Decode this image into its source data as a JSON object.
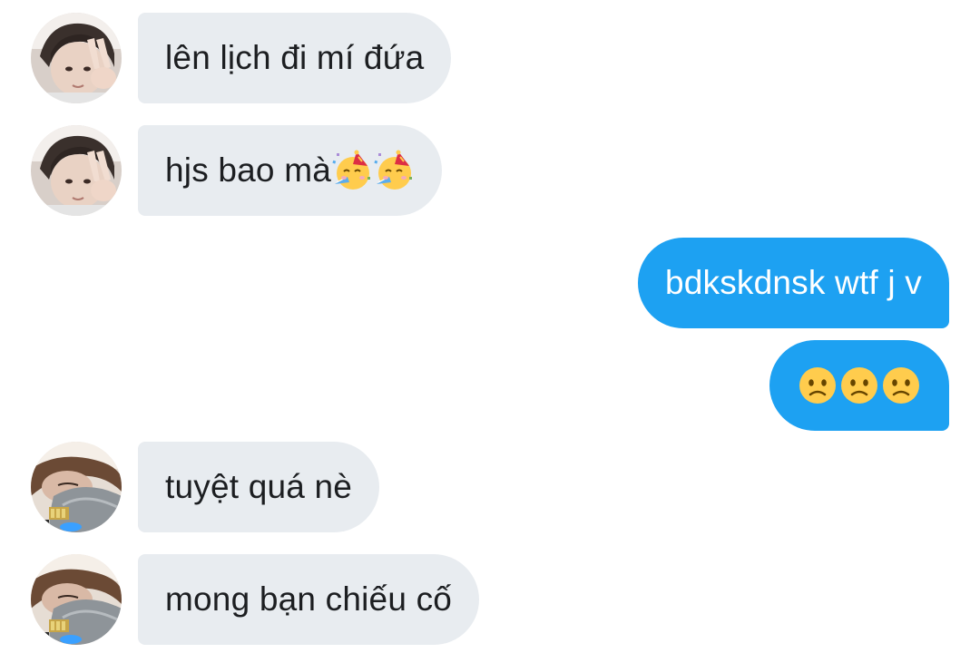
{
  "messages": [
    {
      "direction": "incoming",
      "text": "lên lịch đi mí đứa",
      "avatar": "avatar-person-peace-sign"
    },
    {
      "direction": "incoming",
      "text": "hjs bao mà",
      "emojis": [
        "partying-face-icon",
        "partying-face-icon"
      ],
      "avatar": "avatar-person-peace-sign"
    },
    {
      "direction": "outgoing",
      "text": "bdkskdnsk wtf j v"
    },
    {
      "direction": "outgoing",
      "text": "",
      "emojis": [
        "frowning-face-icon",
        "frowning-face-icon",
        "frowning-face-icon"
      ]
    },
    {
      "direction": "incoming",
      "text": "tuyệt quá nè",
      "avatar": "avatar-person-resting"
    },
    {
      "direction": "incoming",
      "text": "mong bạn chiếu cố",
      "avatar": "avatar-person-resting"
    }
  ],
  "colors": {
    "incoming_bubble": "#e8ecf0",
    "outgoing_bubble": "#1da1f2",
    "incoming_text": "#1c1e21",
    "outgoing_text": "#ffffff"
  }
}
